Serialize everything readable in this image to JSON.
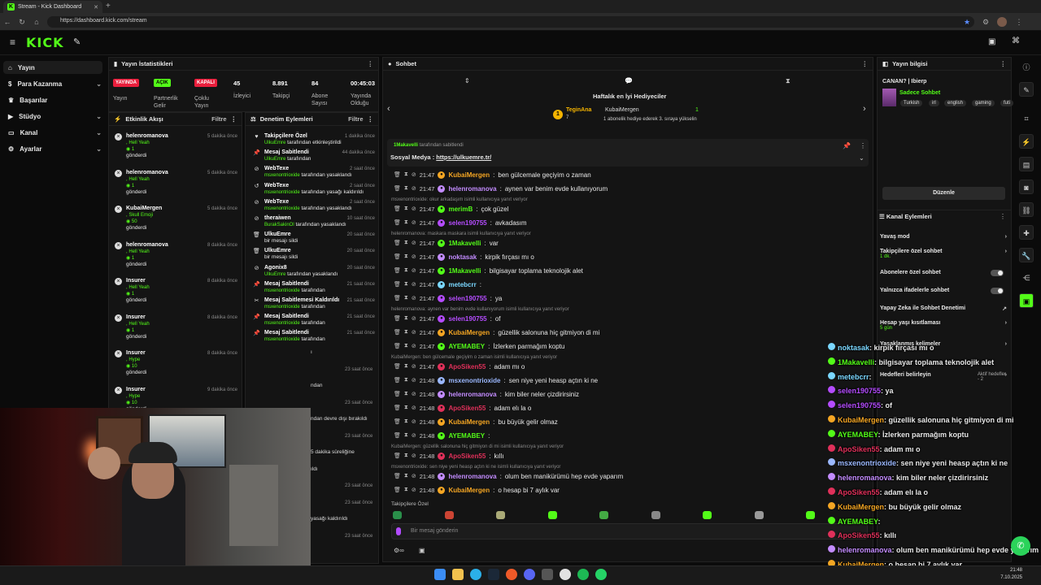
{
  "browser": {
    "tab_title": "Stream - Kick Dashboard",
    "url": "https://dashboard.kick.com/stream"
  },
  "app": {
    "logo": "KICK"
  },
  "nav": [
    {
      "label": "Yayın",
      "icon": "home-icon"
    },
    {
      "label": "Para Kazanma",
      "icon": "dollar-icon"
    },
    {
      "label": "Başarılar",
      "icon": "trophy-icon"
    },
    {
      "label": "Stüdyo",
      "icon": "studio-icon"
    },
    {
      "label": "Kanal",
      "icon": "channel-icon"
    },
    {
      "label": "Ayarlar",
      "icon": "gear-icon"
    }
  ],
  "stats": {
    "title": "Yayın İstatistikleri",
    "items": [
      {
        "badge": "YAYINDA",
        "label": "Yayın",
        "badge_color": "#e91e3c"
      },
      {
        "badge": "AÇIK",
        "label": "Partnerlik Gelir",
        "badge_color": "#53fc18"
      },
      {
        "badge": "KAPALI",
        "label": "Çoklu Yayın",
        "badge_color": "#e91e3c"
      },
      {
        "value": "45",
        "label": "İzleyici"
      },
      {
        "value": "8.891",
        "label": "Takipçi"
      },
      {
        "value": "84",
        "label": "Abone Sayısı"
      },
      {
        "value": "00:45:03",
        "label": "Yayında Olduğu"
      }
    ]
  },
  "activity": {
    "title": "Etkinlik Akışı",
    "filter": "Filtre",
    "items": [
      {
        "name": "helenromanova",
        "emote": ", Hell Yeah",
        "count": "1",
        "sent": "gönderdi",
        "time": "5 dakika önce"
      },
      {
        "name": "helenromanova",
        "emote": ", Hell Yeah",
        "count": "1",
        "sent": "gönderdi",
        "time": "5 dakika önce"
      },
      {
        "name": "KubaiMergen",
        "emote": ", Skull Emoji",
        "count": "50",
        "sent": "gönderdi",
        "time": "5 dakika önce"
      },
      {
        "name": "helenromanova",
        "emote": ", Hell Yeah",
        "count": "1",
        "sent": "gönderdi",
        "time": "8 dakika önce"
      },
      {
        "name": "Insurer",
        "emote": ", Hell Yeah",
        "count": "1",
        "sent": "gönderdi",
        "time": "8 dakika önce"
      },
      {
        "name": "Insurer",
        "emote": ", Hell Yeah",
        "count": "1",
        "sent": "gönderdi",
        "time": "8 dakika önce"
      },
      {
        "name": "Insurer",
        "emote": ", Hype",
        "count": "10",
        "sent": "gönderdi",
        "time": "8 dakika önce"
      },
      {
        "name": "Insurer",
        "emote": ", Hype",
        "count": "10",
        "sent": "gönderdi",
        "time": "9 dakika önce"
      }
    ]
  },
  "mod": {
    "title": "Denetim Eylemleri",
    "filter": "Filtre",
    "items": [
      {
        "title": "Takipçilere Özel",
        "by": "UlkuEmre",
        "rest": " tarafından etkinleştirildi",
        "time": "1 dakika önce",
        "icon": "heart-icon"
      },
      {
        "title": "Mesaj Sabitlendi",
        "by": "UlkuEmre",
        "rest": " tarafından",
        "time": "44 dakika önce",
        "icon": "pin-icon"
      },
      {
        "title": "WebTexe",
        "by": "msxenontrioxide",
        "rest": " tarafından yasaklandı",
        "time": "2 saat önce",
        "icon": "ban-icon"
      },
      {
        "title": "WebTexe",
        "by": "msxenontrioxide",
        "rest": " tarafından yasağı kaldırıldı",
        "time": "2 saat önce",
        "icon": "undo-icon"
      },
      {
        "title": "WebTexe",
        "by": "msxenontrioxide",
        "rest": " tarafından yasaklandı",
        "time": "2 saat önce",
        "icon": "ban-icon"
      },
      {
        "title": "theraiwen",
        "by": "BurakSakinOl",
        "rest": " tarafından yasaklandı",
        "time": "10 saat önce",
        "icon": "ban-icon"
      },
      {
        "title": "UlkuEmre",
        "by": "",
        "rest": "bir mesajı sildi",
        "time": "20 saat önce",
        "icon": "trash-icon"
      },
      {
        "title": "UlkuEmre",
        "by": "",
        "rest": "bir mesajı sildi",
        "time": "20 saat önce",
        "icon": "trash-icon"
      },
      {
        "title": "Agonix8",
        "by": "UlkuEmre",
        "rest": " tarafından yasaklandı",
        "time": "20 saat önce",
        "icon": "ban-icon"
      },
      {
        "title": "Mesaj Sabitlendi",
        "by": "msxenontrioxide",
        "rest": " tarafından",
        "time": "21 saat önce",
        "icon": "pin-icon"
      },
      {
        "title": "Mesaj Sabitlemesi Kaldırıldı",
        "by": "msxenontrioxide",
        "rest": " tarafından",
        "time": "21 saat önce",
        "icon": "unpin-icon"
      },
      {
        "title": "Mesaj Sabitlendi",
        "by": "msxenontrioxide",
        "rest": " tarafından",
        "time": "21 saat önce",
        "icon": "pin-icon"
      },
      {
        "title": "Mesaj Sabitlendi",
        "by": "msxenontrioxide",
        "rest": " tarafından",
        "time": "21 saat önce",
        "icon": "pin-icon"
      }
    ],
    "tail": [
      {
        "text": "ı",
        "time": ""
      },
      {
        "text": "",
        "time": "23 saat önce"
      },
      {
        "text": "ndan",
        "time": ""
      },
      {
        "text": "",
        "time": "23 saat önce"
      },
      {
        "text": "ndan devre dışı bırakıldı",
        "time": ""
      },
      {
        "text": "",
        "time": "23 saat önce"
      },
      {
        "text": "5 dakika süreliğine",
        "time": ""
      },
      {
        "text": "ıldı",
        "time": ""
      },
      {
        "text": "",
        "time": "23 saat önce"
      },
      {
        "text": "",
        "time": "23 saat önce"
      },
      {
        "text": "yasağı kaldırıldı",
        "time": ""
      },
      {
        "text": "",
        "time": "23 saat önce"
      }
    ]
  },
  "chat": {
    "title": "Sohbet",
    "gifters_title": "Haftalık en İyi Hediyeciler",
    "gifter1": {
      "name": "TeginAna",
      "count": "7"
    },
    "gifter2": {
      "name": "KubaiMergen",
      "count": "1",
      "note": "1 abonelik hediye ederek 3. sıraya yükselin"
    },
    "pinned": {
      "by": "1Makavelli",
      "by_note": "tarafından sabitlendi",
      "label": "Sosyal Medya :",
      "link": "https://ulkuemre.tr/"
    },
    "messages": [
      {
        "time": "21:47",
        "user": "KubaiMergen",
        "color": "#f5a623",
        "text": "ben gülcemale geçiyim o zaman"
      },
      {
        "time": "21:47",
        "user": "helenromanova",
        "color": "#c38cff",
        "text": "aynen var benim evde kullanıyorum"
      },
      {
        "time": "21:47",
        "user": "merimB",
        "color": "#53fc18",
        "text": "çok güzel",
        "reply": "msxenontrioxide: okur arkadaşım isimli kullanıcıya yanıt veriyor"
      },
      {
        "time": "21:47",
        "user": "selen190755",
        "color": "#b54cff",
        "text": "avkadasım"
      },
      {
        "time": "21:47",
        "user": "1Makavelli",
        "color": "#53fc18",
        "text": "var",
        "reply": "helenromanova: maskara maskara isimli kullanıcıya yanıt veriyor"
      },
      {
        "time": "21:47",
        "user": "noktasak",
        "color": "#c38cff",
        "text": "kirpik fırçası mı o"
      },
      {
        "time": "21:47",
        "user": "1Makavelli",
        "color": "#53fc18",
        "text": "bilgisayar toplama teknolojik alet"
      },
      {
        "time": "21:47",
        "user": "metebcrr",
        "color": "#7ad7ff",
        "text": ""
      },
      {
        "time": "21:47",
        "user": "selen190755",
        "color": "#b54cff",
        "text": "ya"
      },
      {
        "time": "21:47",
        "user": "selen190755",
        "color": "#b54cff",
        "text": "of",
        "reply": "helenromanova: aynen var benim evde kullanıyorum isimli kullanıcıya yanıt veriyor"
      },
      {
        "time": "21:47",
        "user": "KubaiMergen",
        "color": "#f5a623",
        "text": "güzellik salonuna hiç gitmiyon di mi"
      },
      {
        "time": "21:47",
        "user": "AYEMABEY",
        "color": "#53fc18",
        "text": "İzlerken parmağım koptu"
      },
      {
        "time": "21:47",
        "user": "ApoSiken55",
        "color": "#e0305a",
        "text": "adam mı o",
        "reply": "KubaiMergen: ben gülcemale geçiyim o zaman isimli kullanıcıya yanıt veriyor"
      },
      {
        "time": "21:48",
        "user": "msxenontrioxide",
        "color": "#9bb8ff",
        "text": "sen niye yeni heasp açtın ki ne"
      },
      {
        "time": "21:48",
        "user": "helenromanova",
        "color": "#c38cff",
        "text": "kim biler neler çizdirirsiniz"
      },
      {
        "time": "21:48",
        "user": "ApoSiken55",
        "color": "#e0305a",
        "text": "adam elı la o"
      },
      {
        "time": "21:48",
        "user": "KubaiMergen",
        "color": "#f5a623",
        "text": "bu büyük gelir olmaz"
      },
      {
        "time": "21:48",
        "user": "AYEMABEY",
        "color": "#53fc18",
        "text": ""
      },
      {
        "time": "21:48",
        "user": "ApoSiken55",
        "color": "#e0305a",
        "text": "kıllı",
        "reply": "KubaiMergen: güzellik salonuna hiç gitmiyon di mi isimli kullanıcıya yanıt veriyor"
      },
      {
        "time": "21:48",
        "user": "helenromanova",
        "color": "#c38cff",
        "text": "olum ben manikürümü hep evde yaparım",
        "reply": "msxenontrioxide: sen niye yeni heasp açtın ki ne isimli kullanıcıya yanıt veriyor"
      },
      {
        "time": "21:48",
        "user": "KubaiMergen",
        "color": "#f5a623",
        "text": "o hesap bi 7 aylık var"
      }
    ],
    "followers_only": "Takipçilere Özel",
    "input_placeholder": "Bir mesaj gönderin"
  },
  "streaminfo": {
    "title": "Yayın bilgisi",
    "stream_title": "CANAN? | Ibierp",
    "category": "Sadece Sohbet",
    "tags": [
      "Turkish",
      "irl",
      "english",
      "gaming",
      "futi"
    ],
    "edit": "Düzenle"
  },
  "channel_actions": {
    "title": "Kanal Eylemleri",
    "rows": [
      {
        "label": "Yavaş mod",
        "kind": "chevron"
      },
      {
        "label": "Takipçilere özel sohbet",
        "sub": "1 dk.",
        "kind": "chevron"
      },
      {
        "label": "Abonelere özel sohbet",
        "kind": "toggle"
      },
      {
        "label": "Yalnızca ifadelerle sohbet",
        "kind": "toggle"
      },
      {
        "label": "Yapay Zeka ile Sohbet Denetimi",
        "kind": "link"
      },
      {
        "label": "Hesap yaşı kısıtlaması",
        "sub": "5 gün",
        "kind": "chevron"
      },
      {
        "label": "Yasaklanmış kelimeler",
        "kind": "chevron"
      },
      {
        "label": "Hedefleri belirleyin",
        "sub": "Aktif hedefler - 2",
        "kind": "chevron"
      }
    ]
  },
  "overlay": [
    {
      "user": "noktasak",
      "text": ": kirpik fırçası mı o",
      "color": "#7ad7ff"
    },
    {
      "user": "1Makavelli",
      "text": ": bilgisayar toplama teknolojik alet",
      "color": "#53fc18"
    },
    {
      "user": "metebcrr",
      "text": ":",
      "color": "#7ad7ff"
    },
    {
      "user": "selen190755",
      "text": ": ya",
      "color": "#b54cff"
    },
    {
      "user": "selen190755",
      "text": ": of",
      "color": "#b54cff"
    },
    {
      "user": "KubaiMergen",
      "text": ": güzellik salonuna hiç gitmiyon di mi",
      "color": "#f5a623"
    },
    {
      "user": "AYEMABEY",
      "text": ": İzlerken parmağım koptu",
      "color": "#53fc18"
    },
    {
      "user": "ApoSiken55",
      "text": ": adam mı o",
      "color": "#e0305a"
    },
    {
      "user": "msxenontrioxide",
      "text": ": sen niye yeni heasp açtın ki ne",
      "color": "#9bb8ff"
    },
    {
      "user": "helenromanova",
      "text": ": kim biler neler çizdirirsiniz",
      "color": "#c38cff"
    },
    {
      "user": "ApoSiken55",
      "text": ": adam elı la o",
      "color": "#e0305a"
    },
    {
      "user": "KubaiMergen",
      "text": ": bu büyük gelir olmaz",
      "color": "#f5a623"
    },
    {
      "user": "AYEMABEY",
      "text": ":",
      "color": "#53fc18"
    },
    {
      "user": "ApoSiken55",
      "text": ": kıllı",
      "color": "#e0305a"
    },
    {
      "user": "helenromanova",
      "text": ": olum ben manikürümü hep evde yaparım",
      "color": "#c38cff"
    },
    {
      "user": "KubaiMergen",
      "text": ": o hesap bi 7 aylık var",
      "color": "#f5a623"
    }
  ],
  "taskbar": {
    "time": "21:48",
    "date": "7.10.2025"
  }
}
